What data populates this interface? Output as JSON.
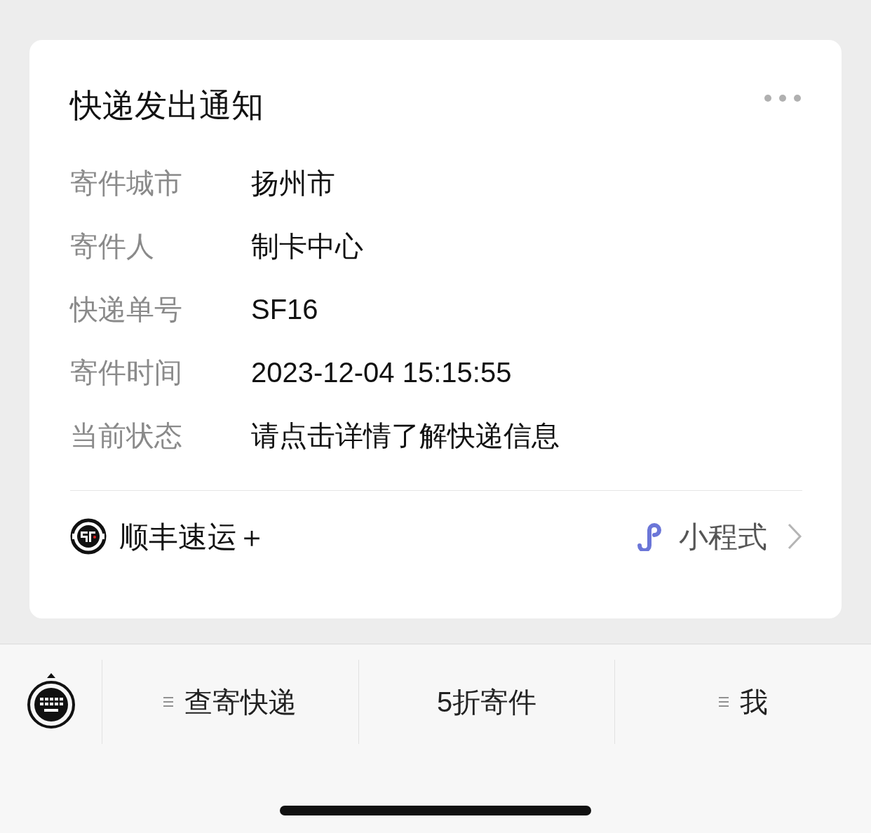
{
  "card": {
    "title": "快递发出通知",
    "fields": [
      {
        "label": "寄件城市",
        "value": "扬州市"
      },
      {
        "label": "寄件人",
        "value": "制卡中心"
      },
      {
        "label": "快递单号",
        "value": "SF16"
      },
      {
        "label": "寄件时间",
        "value": "2023-12-04 15:15:55"
      },
      {
        "label": "当前状态",
        "value": "请点击详情了解快递信息"
      }
    ],
    "source": {
      "name": "顺丰速运＋"
    },
    "link": {
      "label": "小程式"
    }
  },
  "menu": [
    {
      "label": "查寄快递",
      "submenu": true
    },
    {
      "label": "5折寄件",
      "submenu": false
    },
    {
      "label": "我",
      "submenu": true
    }
  ]
}
